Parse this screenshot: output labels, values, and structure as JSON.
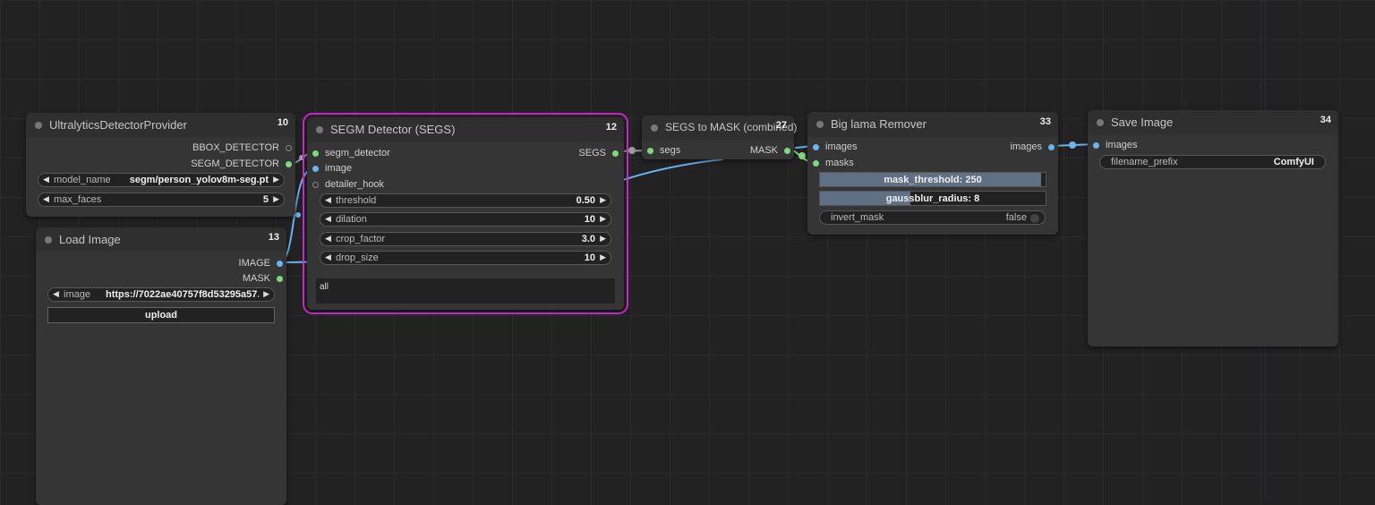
{
  "nodes": {
    "ultralytics": {
      "title": "UltralyticsDetectorProvider",
      "id": "10",
      "outputs": [
        "BBOX_DETECTOR",
        "SEGM_DETECTOR"
      ],
      "widgets": [
        {
          "label": "model_name",
          "value": "segm/person_yolov8m-seg.pt"
        },
        {
          "label": "max_faces",
          "value": "5"
        }
      ]
    },
    "load_image": {
      "title": "Load Image",
      "id": "13",
      "outputs": [
        "IMAGE",
        "MASK"
      ],
      "image_label": "image",
      "image_value": "https://7022ae40757f8d53295a57...",
      "upload_label": "upload"
    },
    "segm_detector": {
      "title": "SEGM Detector (SEGS)",
      "id": "12",
      "inputs": [
        "segm_detector",
        "image",
        "detailer_hook"
      ],
      "output": "SEGS",
      "widgets": [
        {
          "label": "threshold",
          "value": "0.50"
        },
        {
          "label": "dilation",
          "value": "10"
        },
        {
          "label": "crop_factor",
          "value": "3.0"
        },
        {
          "label": "drop_size",
          "value": "10"
        }
      ],
      "text": "all"
    },
    "segs_to_mask": {
      "title": "SEGS to MASK (combined)",
      "id": "27",
      "input": "segs",
      "output": "MASK"
    },
    "big_lama": {
      "title": "Big lama Remover",
      "id": "33",
      "inputs": [
        "images",
        "masks"
      ],
      "output": "images",
      "sliders": [
        {
          "text": "mask_threshold: 250",
          "fraction": 0.98
        },
        {
          "text": "gaussblur_radius: 8",
          "fraction": 0.4
        }
      ],
      "toggle": {
        "label": "invert_mask",
        "value": "false"
      }
    },
    "save_image": {
      "title": "Save Image",
      "id": "34",
      "input": "images",
      "widget": {
        "label": "filename_prefix",
        "value": "ComfyUI"
      }
    }
  },
  "colors": {
    "image_link": "#6ab4f0",
    "mask_link": "#7ed97e",
    "selection": "#c727c7"
  }
}
